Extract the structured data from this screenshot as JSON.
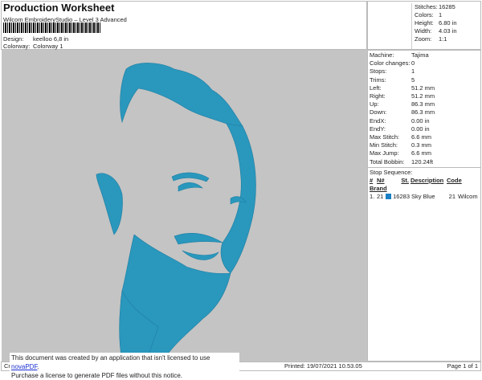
{
  "header": {
    "title": "Production Worksheet",
    "subtitle": "Wilcom EmbroideryStudio – Level 3 Advanced",
    "design_label": "Design:",
    "design_value": "keelloo 6,8 in",
    "colorway_label": "Colorway:",
    "colorway_value": "Colorway 1"
  },
  "stats": [
    {
      "k": "Stitches:",
      "v": "16285"
    },
    {
      "k": "Colors:",
      "v": "1"
    },
    {
      "k": "Height:",
      "v": "6.80 in"
    },
    {
      "k": "Width:",
      "v": "4.03 in"
    },
    {
      "k": "Zoom:",
      "v": "1:1"
    }
  ],
  "machine": [
    {
      "k": "Machine:",
      "v": "Tajima"
    },
    {
      "k": "Color changes:",
      "v": "0"
    },
    {
      "k": "Stops:",
      "v": "1"
    },
    {
      "k": "Trims:",
      "v": "5"
    },
    {
      "k": "Left:",
      "v": "51.2 mm"
    },
    {
      "k": "Right:",
      "v": "51.2 mm"
    },
    {
      "k": "Up:",
      "v": "86.3 mm"
    },
    {
      "k": "Down:",
      "v": "86.3 mm"
    },
    {
      "k": "EndX:",
      "v": "0.00 in"
    },
    {
      "k": "EndY:",
      "v": "0.00 in"
    },
    {
      "k": "Max Stitch:",
      "v": "6.6 mm"
    },
    {
      "k": "Min Stitch:",
      "v": "0.3 mm"
    },
    {
      "k": "Max Jump:",
      "v": "6.6 mm"
    },
    {
      "k": "Total Bobbin:",
      "v": "120.24ft"
    }
  ],
  "sequence": {
    "title": "Stop Sequence:",
    "headers": [
      "#",
      "N#",
      "St.",
      "Description",
      "Code",
      "Brand"
    ],
    "rows": [
      {
        "num": "1.",
        "n": "21",
        "color": "#1a7fc4",
        "st": "16283",
        "desc": "Sky Blue",
        "code": "21",
        "brand": "Wilcom"
      }
    ]
  },
  "design_color": "#2a97bd",
  "footer": {
    "left": "Cr",
    "printed": "Printed: 19/07/2021 10.53.05",
    "page": "Page 1 of 1"
  },
  "notice": {
    "line1": "This document was created by an application that isn't licensed to use ",
    "link": "novaPDF",
    "line1_end": ".",
    "line2": "Purchase a license to generate PDF files without this notice."
  }
}
